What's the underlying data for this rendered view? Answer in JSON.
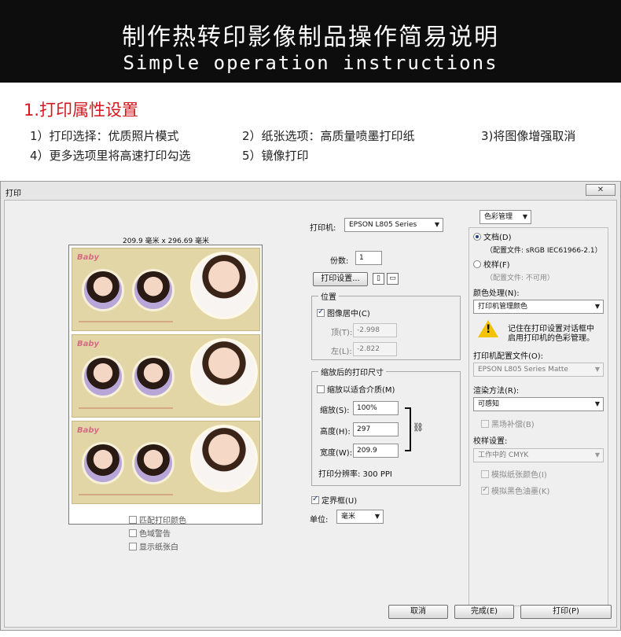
{
  "banner": {
    "title": "制作热转印影像制品操作简易说明",
    "subtitle": "Simple operation instructions"
  },
  "section": {
    "title": "1.打印属性设置",
    "steps": [
      "1）打印选择：优质照片模式",
      "2）纸张选项：高质量喷墨打印纸",
      "3)将图像增强取消",
      "4）更多选项里将高速打印勾选",
      "5）镜像打印"
    ]
  },
  "dialog": {
    "title": "打印",
    "close_glyph": "✕",
    "preview": {
      "size_label": "209.9 毫米 x 296.69 毫米",
      "panel_logo": "Baby",
      "options": [
        {
          "label": "匹配打印颜色",
          "checked": false
        },
        {
          "label": "色域警告",
          "checked": false
        },
        {
          "label": "显示纸张白",
          "checked": false
        }
      ]
    },
    "printer": {
      "label": "打印机:",
      "value": "EPSON L805 Series",
      "copies_label": "份数:",
      "copies_value": "1",
      "settings_button": "打印设置...",
      "orient_icon_1": "portrait-icon",
      "orient_icon_2": "landscape-icon"
    },
    "position": {
      "group_label": "位置",
      "center_label": "图像居中(C)",
      "center_checked": true,
      "top_label": "顶(T):",
      "top_value": "-2.998",
      "left_label": "左(L):",
      "left_value": "-2.822"
    },
    "scaled": {
      "group_label": "缩放后的打印尺寸",
      "fit_label": "缩放以适合介质(M)",
      "fit_checked": false,
      "scale_label": "缩放(S):",
      "scale_value": "100%",
      "height_label": "高度(H):",
      "height_value": "297",
      "width_label": "宽度(W):",
      "width_value": "209.9",
      "resolution": "打印分辨率: 300 PPI",
      "link_icon": "chain-link-icon"
    },
    "bounding_box": {
      "label": "定界框(U)",
      "checked": true
    },
    "units": {
      "label": "单位:",
      "value": "毫米"
    },
    "color": {
      "menu_label": "色彩管理",
      "doc_radio": "文档(D)",
      "doc_profile": "（配置文件: sRGB IEC61966-2.1）",
      "proof_radio": "校样(F)",
      "proof_profile": "（配置文件: 不可用）",
      "handling_label": "颜色处理(N):",
      "handling_value": "打印机管理颜色",
      "warning_text_1": "记住在打印设置对话框中",
      "warning_text_2": "启用打印机的色彩管理。",
      "profile_label": "打印机配置文件(O):",
      "profile_value": "EPSON L805 Series Matte",
      "intent_label": "渲染方法(R):",
      "intent_value": "可感知",
      "bpc_label": "黑场补偿(B)",
      "proof_setup_label": "校样设置:",
      "proof_setup_value": "工作中的 CMYK",
      "sim_paper_label": "模拟纸张颜色(I)",
      "sim_ink_label": "模拟黑色油墨(K)"
    },
    "buttons": {
      "cancel": "取消",
      "done": "完成(E)",
      "print": "打印(P)"
    }
  }
}
